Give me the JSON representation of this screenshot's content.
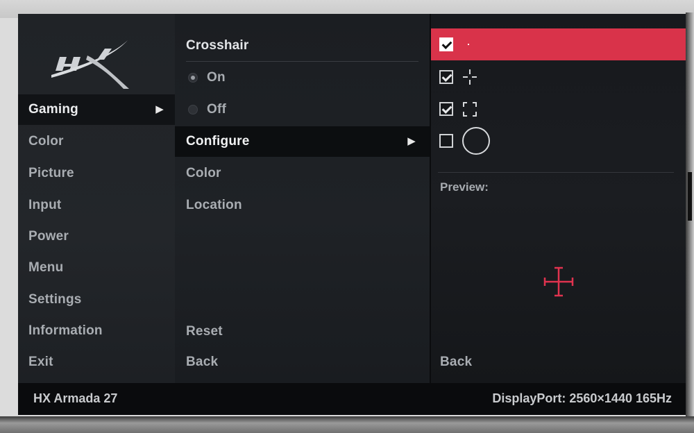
{
  "osd": {
    "brand_logo": "HX",
    "main_menu": {
      "items": [
        {
          "label": "Gaming",
          "active": true
        },
        {
          "label": "Color"
        },
        {
          "label": "Picture"
        },
        {
          "label": "Input"
        },
        {
          "label": "Power"
        },
        {
          "label": "Menu"
        },
        {
          "label": "Settings"
        },
        {
          "label": "Information"
        },
        {
          "label": "Exit"
        }
      ]
    },
    "submenu": {
      "header": "Crosshair",
      "options": {
        "on_label": "On",
        "off_label": "Off",
        "selected": "On"
      },
      "items": [
        {
          "label": "Configure",
          "active": true
        },
        {
          "label": "Color"
        },
        {
          "label": "Location"
        }
      ],
      "reset_label": "Reset",
      "back_label": "Back"
    },
    "configure_panel": {
      "styles": [
        {
          "icon": "dot-crosshair-icon",
          "checked": true,
          "selected": true
        },
        {
          "icon": "cross-crosshair-icon",
          "checked": true
        },
        {
          "icon": "bracket-crosshair-icon",
          "checked": true
        },
        {
          "icon": "circle-crosshair-icon",
          "checked": false
        }
      ],
      "preview_label": "Preview:",
      "back_label": "Back"
    },
    "footer": {
      "model": "HX Armada 27",
      "signal": "DisplayPort: 2560×1440  165Hz"
    },
    "colors": {
      "accent": "#d9334a",
      "preview_crosshair": "#e0334f"
    }
  }
}
